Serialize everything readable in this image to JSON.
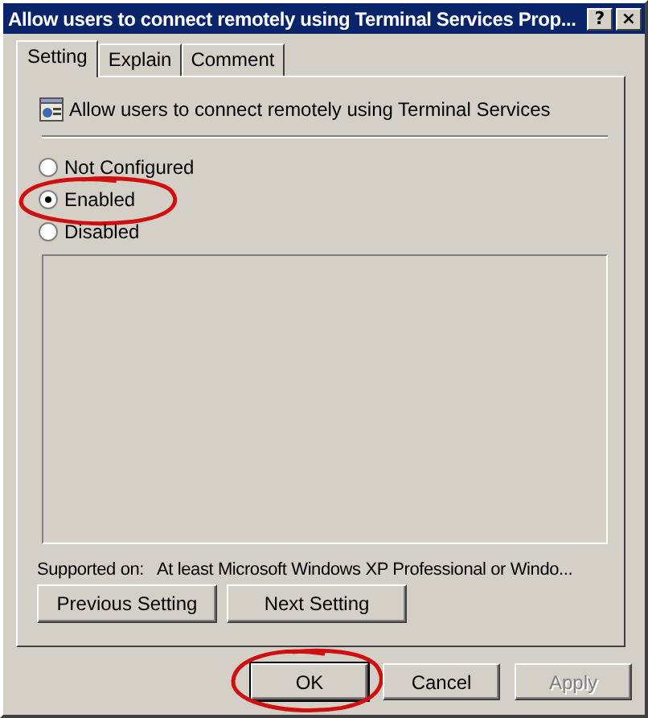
{
  "window": {
    "title": "Allow users to connect remotely using Terminal Services Prop...",
    "title_buttons": [
      "?",
      "×"
    ]
  },
  "tabs": [
    {
      "label": "Setting",
      "selected": true
    },
    {
      "label": "Explain",
      "selected": false
    },
    {
      "label": "Comment",
      "selected": false
    }
  ],
  "policy": {
    "name": "Allow users to connect remotely using Terminal Services"
  },
  "options": [
    {
      "label": "Not Configured",
      "selected": false,
      "circled": false
    },
    {
      "label": "Enabled",
      "selected": true,
      "circled": true
    },
    {
      "label": "Disabled",
      "selected": false,
      "circled": false
    }
  ],
  "supported_on": {
    "label": "Supported on:",
    "value": "At least Microsoft Windows XP Professional or Windo..."
  },
  "nav_buttons": [
    "Previous Setting",
    "Next Setting"
  ],
  "buttons": [
    {
      "label": "OK",
      "disabled": false,
      "circled": true
    },
    {
      "label": "Cancel",
      "disabled": false,
      "circled": false
    },
    {
      "label": "Apply",
      "disabled": true,
      "circled": false
    }
  ]
}
